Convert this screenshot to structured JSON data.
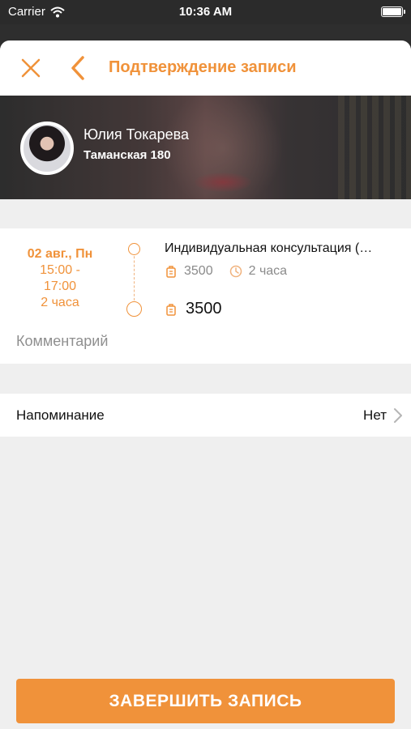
{
  "status_bar": {
    "carrier": "Carrier",
    "time": "10:36 AM"
  },
  "nav": {
    "title": "Подтверждение записи"
  },
  "master": {
    "name": "Юлия Токарева",
    "address": "Таманская 180"
  },
  "booking": {
    "date": "02 авг., Пн",
    "time_start": "15:00 -",
    "time_end": "17:00",
    "duration": "2 часа"
  },
  "service": {
    "name": "Индивидуальная консультация (…",
    "price": "3500",
    "duration": "2 часа",
    "total": "3500"
  },
  "comment": {
    "placeholder": "Комментарий"
  },
  "reminder": {
    "label": "Напоминание",
    "value": "Нет"
  },
  "actions": {
    "finish_label": "ЗАВЕРШИТЬ ЗАПИСЬ"
  },
  "colors": {
    "accent": "#f0923a",
    "background": "#efefef",
    "muted_text": "#8a8a8a"
  },
  "icons": {
    "close": "close-icon",
    "back": "chevron-left-icon",
    "price": "price-tag-icon",
    "duration": "clock-icon",
    "reminder": "chevron-right-icon",
    "wifi": "wifi-icon",
    "battery": "battery-icon"
  }
}
